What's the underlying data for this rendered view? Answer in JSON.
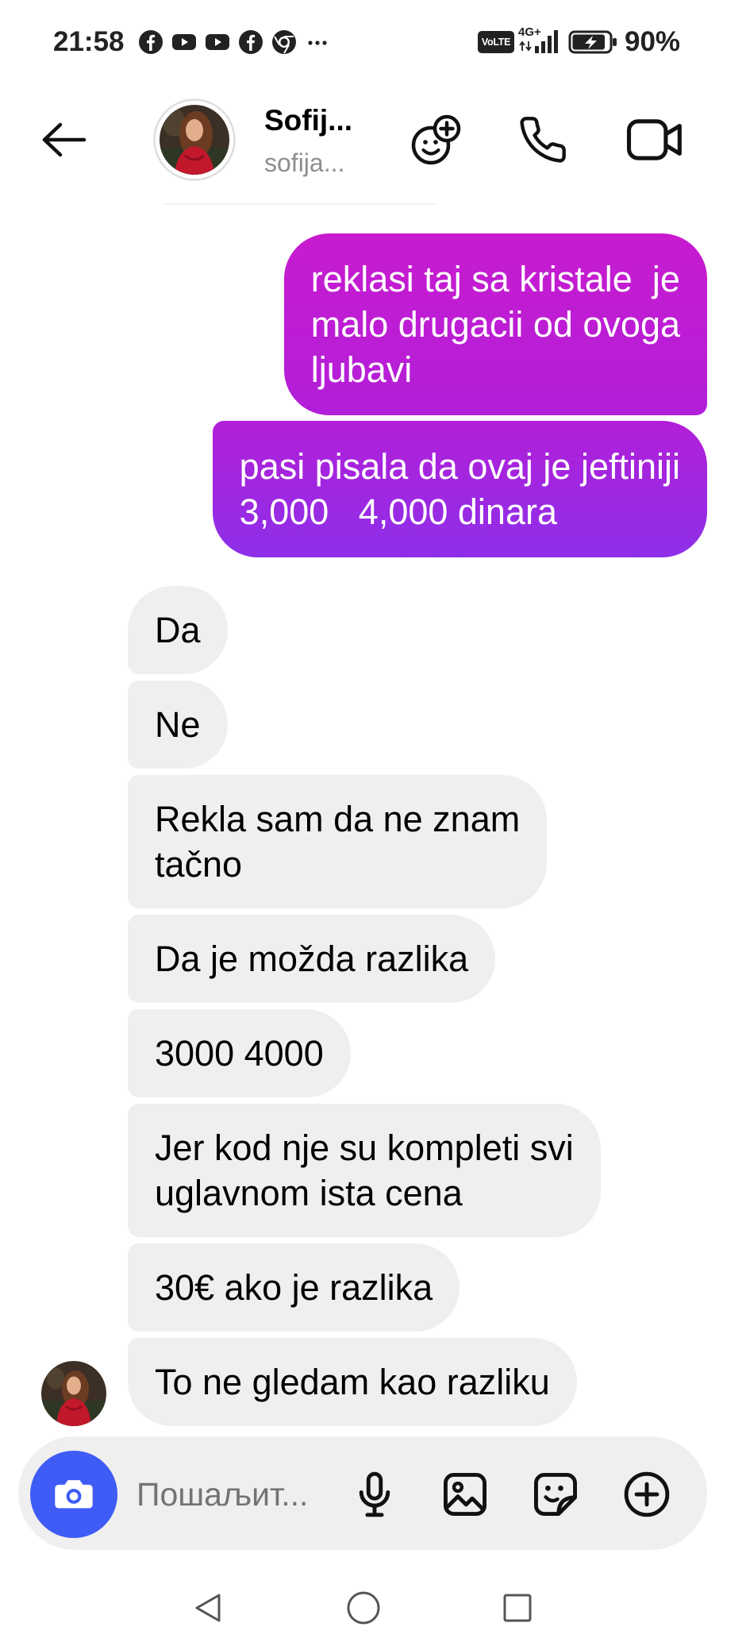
{
  "status_bar": {
    "time": "21:58",
    "notification_icons": [
      "facebook-icon",
      "youtube-icon",
      "youtube-icon",
      "facebook-icon",
      "chrome-icon",
      "more-notifications-icon"
    ],
    "volte_label": "VoLTE",
    "network_label": "4G+",
    "battery_percent": "90%",
    "battery_level": 0.9,
    "charging": true
  },
  "header": {
    "contact_name": "Sofij...",
    "contact_username": "sofija...",
    "action_icons": [
      "effects-icon",
      "phone-icon",
      "video-icon"
    ]
  },
  "messages": [
    {
      "direction": "sent",
      "text": "reklasi taj sa kristale  je\nmalo drugacii od ovoga\nljubavi"
    },
    {
      "direction": "sent",
      "text": "pasi pisala da ovaj je jeftiniji\n3,000   4,000 dinara"
    },
    {
      "direction": "received",
      "text": "Da"
    },
    {
      "direction": "received",
      "text": "Ne"
    },
    {
      "direction": "received",
      "text": "Rekla sam da ne znam\ntačno"
    },
    {
      "direction": "received",
      "text": "Da je možda razlika"
    },
    {
      "direction": "received",
      "text": "3000 4000"
    },
    {
      "direction": "received",
      "text": "Jer kod nje su kompleti svi\nuglavnom ista cena"
    },
    {
      "direction": "received",
      "text": "30€ ako je razlika"
    },
    {
      "direction": "received",
      "text": "To ne gledam kao razliku"
    }
  ],
  "composer": {
    "placeholder": "Пошаљит...",
    "icons": [
      "camera-icon",
      "mic-icon",
      "gallery-icon",
      "sticker-icon",
      "plus-icon"
    ]
  },
  "nav_bar": {
    "icons": [
      "nav-back-icon",
      "nav-home-icon",
      "nav-recents-icon"
    ]
  },
  "colors": {
    "sent_bubble_top": "#c81bcf",
    "sent_bubble_mid": "#b21fd8",
    "sent_bubble_bottom": "#8e2fe9",
    "received_bubble": "#efefef",
    "camera_button": "#3f5cf6",
    "username_gray": "#8e8e8e"
  }
}
